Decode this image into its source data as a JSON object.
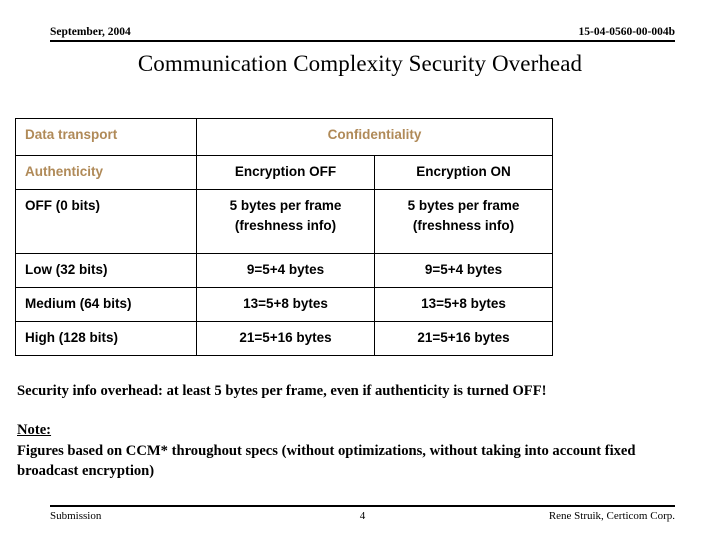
{
  "header": {
    "date": "September, 2004",
    "doc_number": "15-04-0560-00-004b"
  },
  "title": "Communication Complexity Security Overhead",
  "table": {
    "header_color": "#b08a58",
    "row1": {
      "label": "Data transport",
      "group": "Confidentiality"
    },
    "row2": {
      "label": "Authenticity",
      "col_off": "Encryption OFF",
      "col_on": "Encryption ON"
    },
    "rows": [
      {
        "label": "OFF (0 bits)",
        "off_line1": "5 bytes per frame",
        "off_line2": "(freshness info)",
        "on_line1": "5 bytes per frame",
        "on_line2": "(freshness info)"
      },
      {
        "label": "Low (32 bits)",
        "off": "9=5+4 bytes",
        "on": "9=5+4 bytes"
      },
      {
        "label": "Medium (64 bits)",
        "off": "13=5+8 bytes",
        "on": "13=5+8 bytes"
      },
      {
        "label": "High (128 bits)",
        "off": "21=5+16 bytes",
        "on": "21=5+16 bytes"
      }
    ]
  },
  "notes": {
    "security_overhead": "Security info overhead: at least 5 bytes per frame, even if authenticity is turned OFF!",
    "note_heading": "Note:",
    "note_body": "Figures based on CCM* throughout specs (without optimizations, without taking into account fixed broadcast encryption)"
  },
  "footer": {
    "left": "Submission",
    "page": "4",
    "right": "Rene Struik, Certicom Corp."
  }
}
